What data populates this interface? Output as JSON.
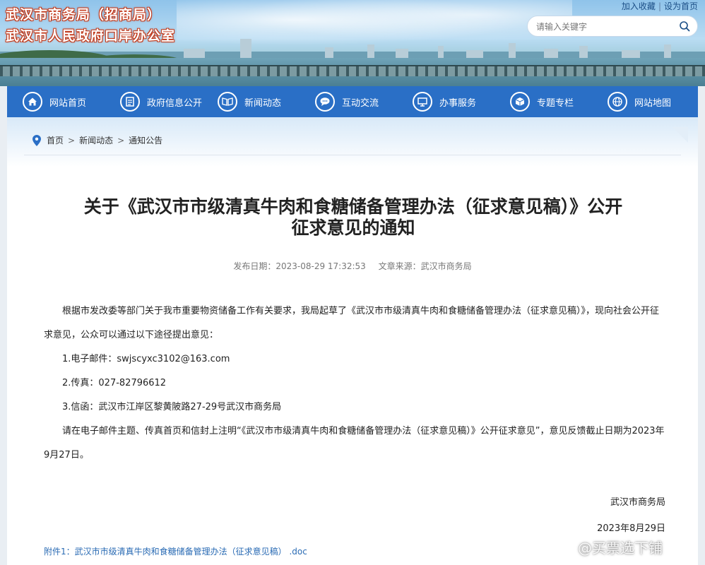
{
  "header": {
    "org_name": "武汉市商务局（招商局）",
    "office_name": "武汉市人民政府口岸办公室",
    "links": [
      "加入收藏",
      "设为首页"
    ],
    "search_placeholder": "请输入关键字"
  },
  "nav": [
    {
      "label": "网站首页",
      "icon": "home-icon"
    },
    {
      "label": "政府信息公开",
      "icon": "document-icon"
    },
    {
      "label": "新闻动态",
      "icon": "book-icon"
    },
    {
      "label": "互动交流",
      "icon": "chat-icon"
    },
    {
      "label": "办事服务",
      "icon": "monitor-icon"
    },
    {
      "label": "专题专栏",
      "icon": "box-icon"
    },
    {
      "label": "网站地图",
      "icon": "globe-icon"
    }
  ],
  "breadcrumb": [
    "首页",
    "新闻动态",
    "通知公告"
  ],
  "article": {
    "title_line1": "关于《武汉市市级清真牛肉和食糖储备管理办法（征求意见稿）》公开",
    "title_line2": "征求意见的通知",
    "date": "发布日期：2023-08-29 17:32:53",
    "source": "文章来源：武汉市商务局",
    "intro": "根据市发改委等部门关于我市重要物资储备工作有关要求，我局起草了《武汉市市级清真牛肉和食糖储备管理办法（征求意见稿）》，现向社会公开征求意见，公众可以通过以下途径提出意见：",
    "item1": "1.电子邮件：swjscyxc3102@163.com",
    "item2": "2.传真：027-82796612",
    "item3": "3.信函：武汉市江岸区黎黄陂路27-29号武汉市商务局",
    "closing": "请在电子邮件主题、传真首页和信封上注明“《武汉市市级清真牛肉和食糖储备管理办法（征求意见稿）》公开征求意见”，意见反馈截止日期为2023年9月27日。",
    "signature": "武汉市商务局",
    "sign_date": "2023年8月29日",
    "attachment": "附件1：武汉市市级清真牛肉和食糖储备管理办法（征求意见稿） .doc"
  },
  "watermark": "@买票选下铺",
  "colors": {
    "nav_bg": "#2a6fc6",
    "title_outline": "#c23b1d",
    "link": "#2a6bb4"
  }
}
